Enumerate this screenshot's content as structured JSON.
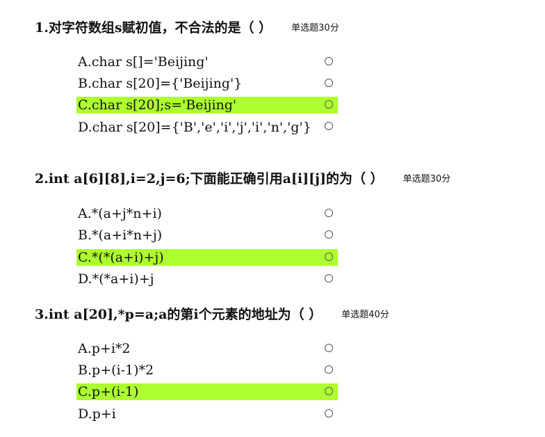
{
  "questions": [
    {
      "number": "1.",
      "text": "对字符数组s赋初值，不合法的是（  ）",
      "type_label": "单选题30分",
      "options": [
        {
          "label": "A.char s[]='Beijing'",
          "selected": false
        },
        {
          "label": "B.char s[20]={'Beijing'}",
          "selected": false
        },
        {
          "label": "C.char s[20];s='Beijing'",
          "selected": true
        },
        {
          "label": "D.char s[20]={'B','e','i','j','i','n','g'}",
          "selected": false
        }
      ]
    },
    {
      "number": "2.",
      "text": "int a[6][8],i=2,j=6;下面能正确引用a[i][j]的为（  ）",
      "type_label": "单选题30分",
      "options": [
        {
          "label": "A.*(a+j*n+i)",
          "selected": false
        },
        {
          "label": "B.*(a+i*n+j)",
          "selected": false
        },
        {
          "label": "C.*(*(a+i)+j)",
          "selected": true
        },
        {
          "label": "D.*(*a+i)+j",
          "selected": false
        }
      ]
    },
    {
      "number": "3.",
      "text": "int a[20],*p=a;a的第i个元素的地址为（  ）",
      "type_label": "单选题40分",
      "options": [
        {
          "label": "A.p+i*2",
          "selected": false
        },
        {
          "label": "B.p+(i-1)*2",
          "selected": false
        },
        {
          "label": "C.p+(i-1)",
          "selected": true
        },
        {
          "label": "D.p+i",
          "selected": false
        }
      ]
    }
  ],
  "colors": {
    "selected_highlight": "#adff2f",
    "radio_border": "#555555",
    "text": "#111111"
  },
  "icons": {
    "option_radio": "radio-circle-icon"
  }
}
